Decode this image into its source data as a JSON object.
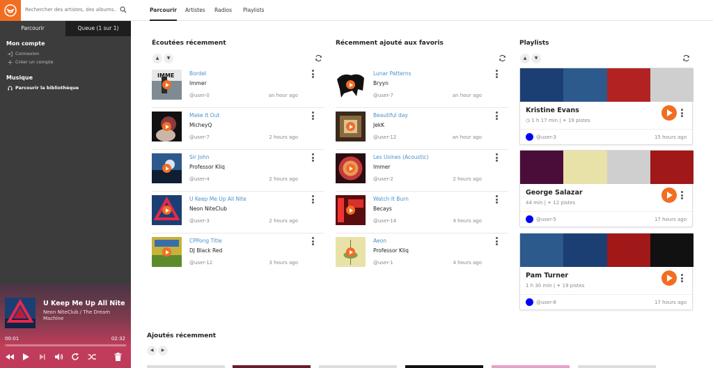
{
  "sidebar": {
    "search_placeholder": "Rechercher des artistes, des albums...",
    "tabs": [
      {
        "label": "Parcourir"
      },
      {
        "label": "Queue (1 sur 1)"
      }
    ],
    "account": {
      "title": "Mon compte",
      "items": [
        {
          "label": "Connexion",
          "icon": "sign-in-icon"
        },
        {
          "label": "Créer un compte",
          "icon": "plus-icon"
        }
      ]
    },
    "music": {
      "title": "Musique",
      "items": [
        {
          "label": "Parcourir la bibliothèque",
          "icon": "headphones-icon"
        }
      ]
    }
  },
  "player": {
    "title": "U Keep Me Up All Nite",
    "artist": "Neon NiteClub",
    "album": "The Dream Machine",
    "artist_album": "Neon NiteClub  /  The Dream Machine",
    "current_time": "00:01",
    "total_time": "02:32",
    "progress": 0.007,
    "controls": [
      "previous-icon",
      "play-icon",
      "next-icon",
      "volume-icon",
      "repeat-icon",
      "shuffle-icon",
      "trash-icon"
    ]
  },
  "nav": {
    "tabs": [
      {
        "label": "Parcourir"
      },
      {
        "label": "Artistes"
      },
      {
        "label": "Radios"
      },
      {
        "label": "Playlists"
      }
    ]
  },
  "recent": {
    "title": "Écoutées récemment",
    "tracks": [
      {
        "title": "Bordel",
        "artist": "Immer",
        "user": "@user-0",
        "time": "an hour ago"
      },
      {
        "title": "Make It Out",
        "artist": "MicheyQ",
        "user": "@user-7",
        "time": "2 hours ago"
      },
      {
        "title": "Sir John",
        "artist": "Professor Kliq",
        "user": "@user-4",
        "time": "2 hours ago"
      },
      {
        "title": "U Keep Me Up All Nite",
        "artist": "Neon NiteClub",
        "user": "@user-3",
        "time": "2 hours ago"
      },
      {
        "title": "CPPong Title",
        "artist": "DJ Black Red",
        "user": "@user-12",
        "time": "3 hours ago"
      }
    ]
  },
  "favorites": {
    "title": "Récemment ajouté aux favoris",
    "tracks": [
      {
        "title": "Lunar Patterns",
        "artist": "Bryyn",
        "user": "@user-7",
        "time": "an hour ago"
      },
      {
        "title": "Beautiful day",
        "artist": "JekK",
        "user": "@user-12",
        "time": "an hour ago"
      },
      {
        "title": "Les Usines (Acoustic)",
        "artist": "Immer",
        "user": "@user-2",
        "time": "2 hours ago"
      },
      {
        "title": "Watch It Burn",
        "artist": "Becays",
        "user": "@user-14",
        "time": "4 hours ago"
      },
      {
        "title": "Aeon",
        "artist": "Professor Kliq",
        "user": "@user-1",
        "time": "4 hours ago"
      }
    ]
  },
  "playlists": {
    "title": "Playlists",
    "items": [
      {
        "name": "Kristine Evans",
        "duration": "1 h 17 min",
        "tracks": "19 pistes",
        "user": "@user-3",
        "time": "15 hours ago"
      },
      {
        "name": "George Salazar",
        "duration": "44 min",
        "tracks": "12 pistes",
        "user": "@user-5",
        "time": "17 hours ago"
      },
      {
        "name": "Pam Turner",
        "duration": "1 h 30 min",
        "tracks": "19 pistes",
        "user": "@user-8",
        "time": "17 hours ago"
      }
    ]
  },
  "added": {
    "title": "Ajoutés récemment"
  },
  "colors": {
    "accent": "#f26d21",
    "link": "#4a90c8",
    "sidebar": "#2b2b2b",
    "sidebar_body": "#3c3c3c",
    "avatar": "#0000ff"
  }
}
